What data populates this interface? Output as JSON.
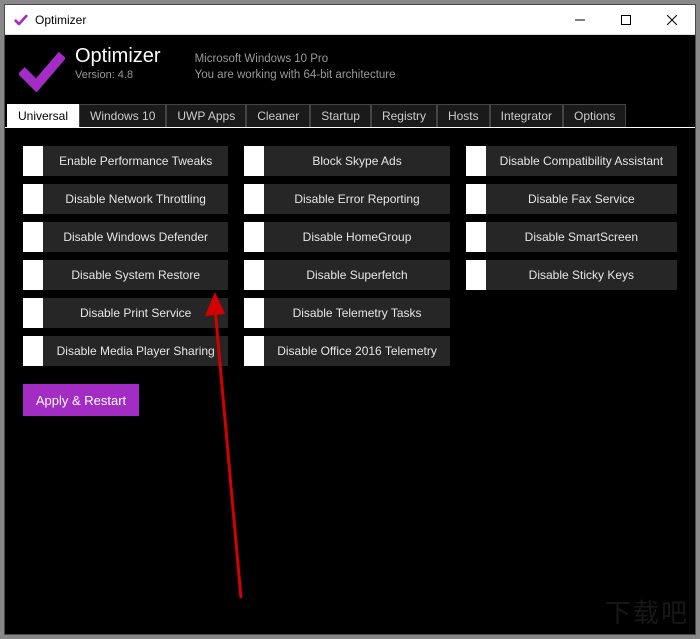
{
  "window": {
    "title": "Optimizer"
  },
  "header": {
    "app_name": "Optimizer",
    "version_label": "Version: 4.8",
    "os_line": "Microsoft Windows 10 Pro",
    "arch_line": "You are working with 64-bit architecture"
  },
  "tabs": [
    {
      "label": "Universal",
      "active": true
    },
    {
      "label": "Windows 10",
      "active": false
    },
    {
      "label": "UWP Apps",
      "active": false
    },
    {
      "label": "Cleaner",
      "active": false
    },
    {
      "label": "Startup",
      "active": false
    },
    {
      "label": "Registry",
      "active": false
    },
    {
      "label": "Hosts",
      "active": false
    },
    {
      "label": "Integrator",
      "active": false
    },
    {
      "label": "Options",
      "active": false
    }
  ],
  "options": {
    "col1": [
      "Enable Performance Tweaks",
      "Disable Network Throttling",
      "Disable Windows Defender",
      "Disable System Restore",
      "Disable Print Service",
      "Disable Media Player Sharing"
    ],
    "col2": [
      "Block Skype Ads",
      "Disable Error Reporting",
      "Disable HomeGroup",
      "Disable Superfetch",
      "Disable Telemetry Tasks",
      "Disable Office 2016 Telemetry"
    ],
    "col3": [
      "Disable Compatibility Assistant",
      "Disable Fax Service",
      "Disable SmartScreen",
      "Disable Sticky Keys"
    ]
  },
  "actions": {
    "apply_label": "Apply & Restart"
  },
  "colors": {
    "accent": "#a32cc4",
    "button_bg": "#262626",
    "bg": "#000000"
  },
  "watermark": "下载吧"
}
